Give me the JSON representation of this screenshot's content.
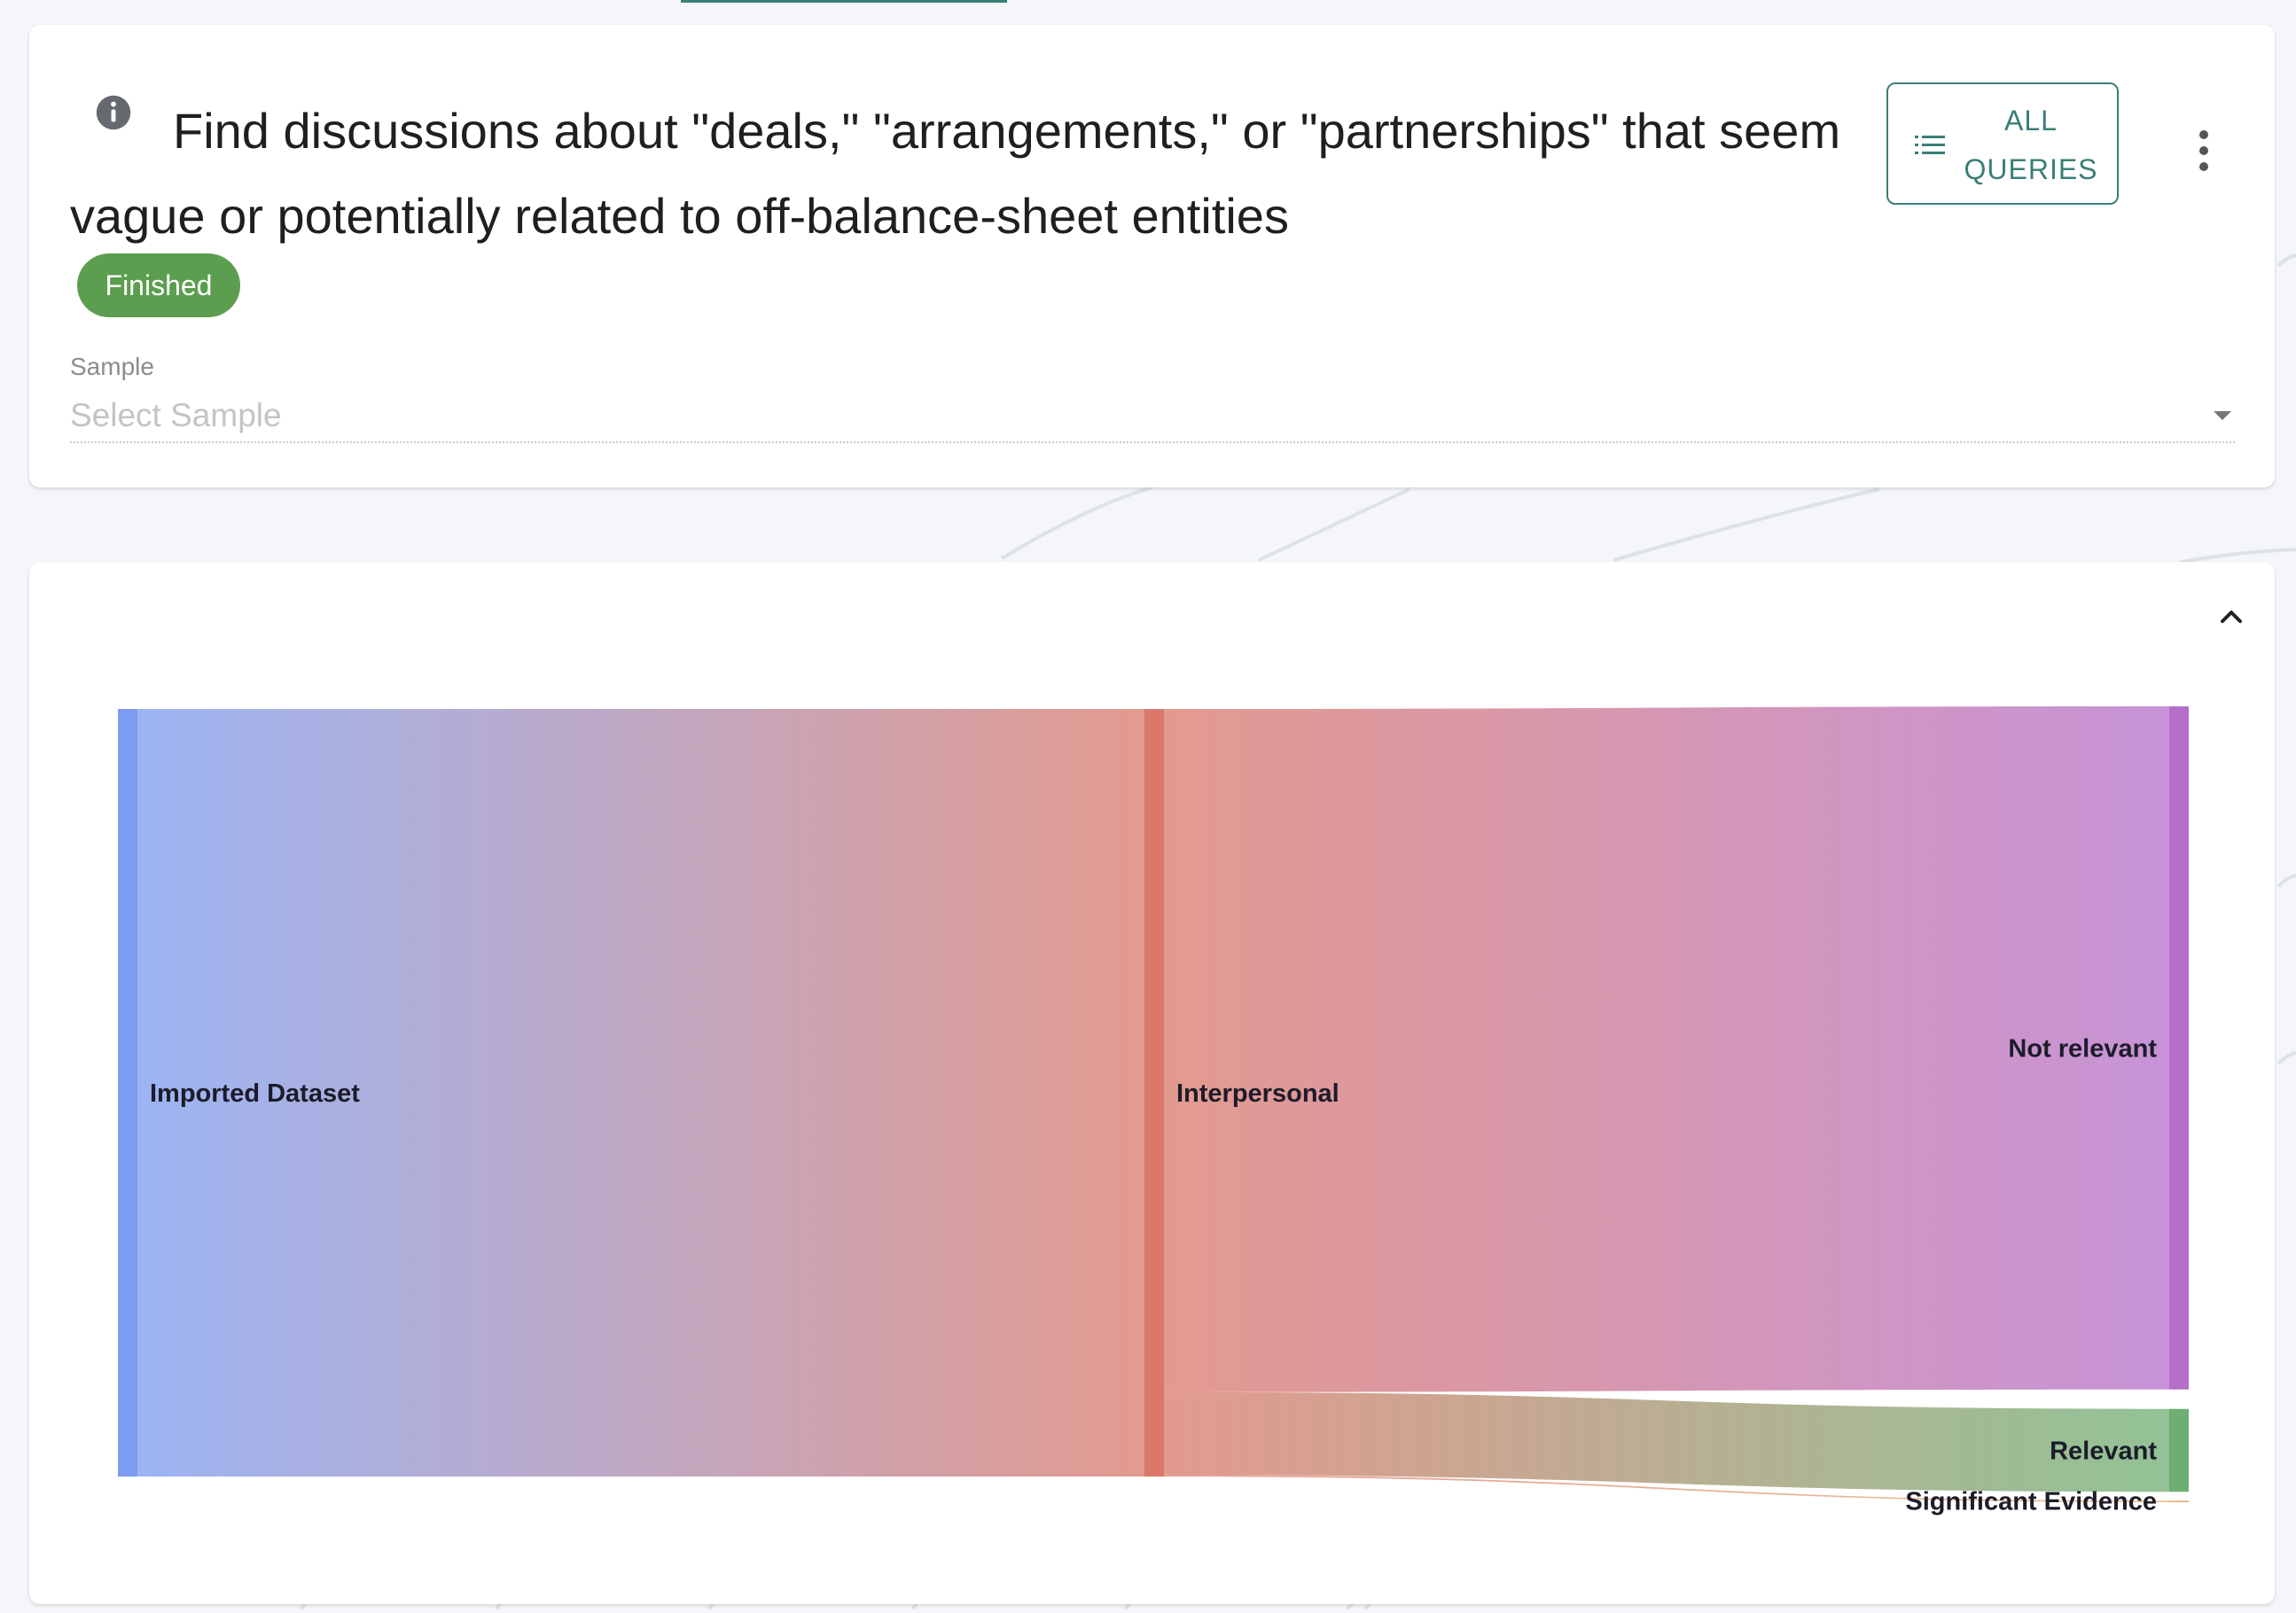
{
  "query_card": {
    "title": "Find discussions about \"deals,\" \"arrangements,\" or \"partnerships\" that seem vague or potentially related to off-balance-sheet entities",
    "status": "Finished",
    "status_color": "#5b9e4f",
    "all_queries_label": "ALL QUERIES",
    "accent_color": "#3a7f77",
    "sample_label": "Sample",
    "sample_placeholder": "Select Sample"
  },
  "icons": {
    "info": "info-icon",
    "list": "list-icon",
    "more": "more-vert-icon",
    "dropdown": "caret-down-icon",
    "collapse": "chevron-up-icon"
  },
  "chart_data": {
    "type": "sankey",
    "nodes": [
      {
        "id": "imported",
        "label": "Imported Dataset",
        "color": "#7b9cf0"
      },
      {
        "id": "interpersonal",
        "label": "Interpersonal",
        "color": "#d9786a"
      },
      {
        "id": "not_relevant",
        "label": "Not relevant",
        "color": "#b56fca"
      },
      {
        "id": "relevant",
        "label": "Relevant",
        "color": "#6dae72"
      },
      {
        "id": "significant",
        "label": "Significant Evidence",
        "color": "#e8b07a"
      }
    ],
    "links": [
      {
        "source": "imported",
        "target": "interpersonal",
        "value": 1000
      },
      {
        "source": "interpersonal",
        "target": "not_relevant",
        "value": 890
      },
      {
        "source": "interpersonal",
        "target": "relevant",
        "value": 108
      },
      {
        "source": "interpersonal",
        "target": "significant",
        "value": 2
      }
    ]
  }
}
